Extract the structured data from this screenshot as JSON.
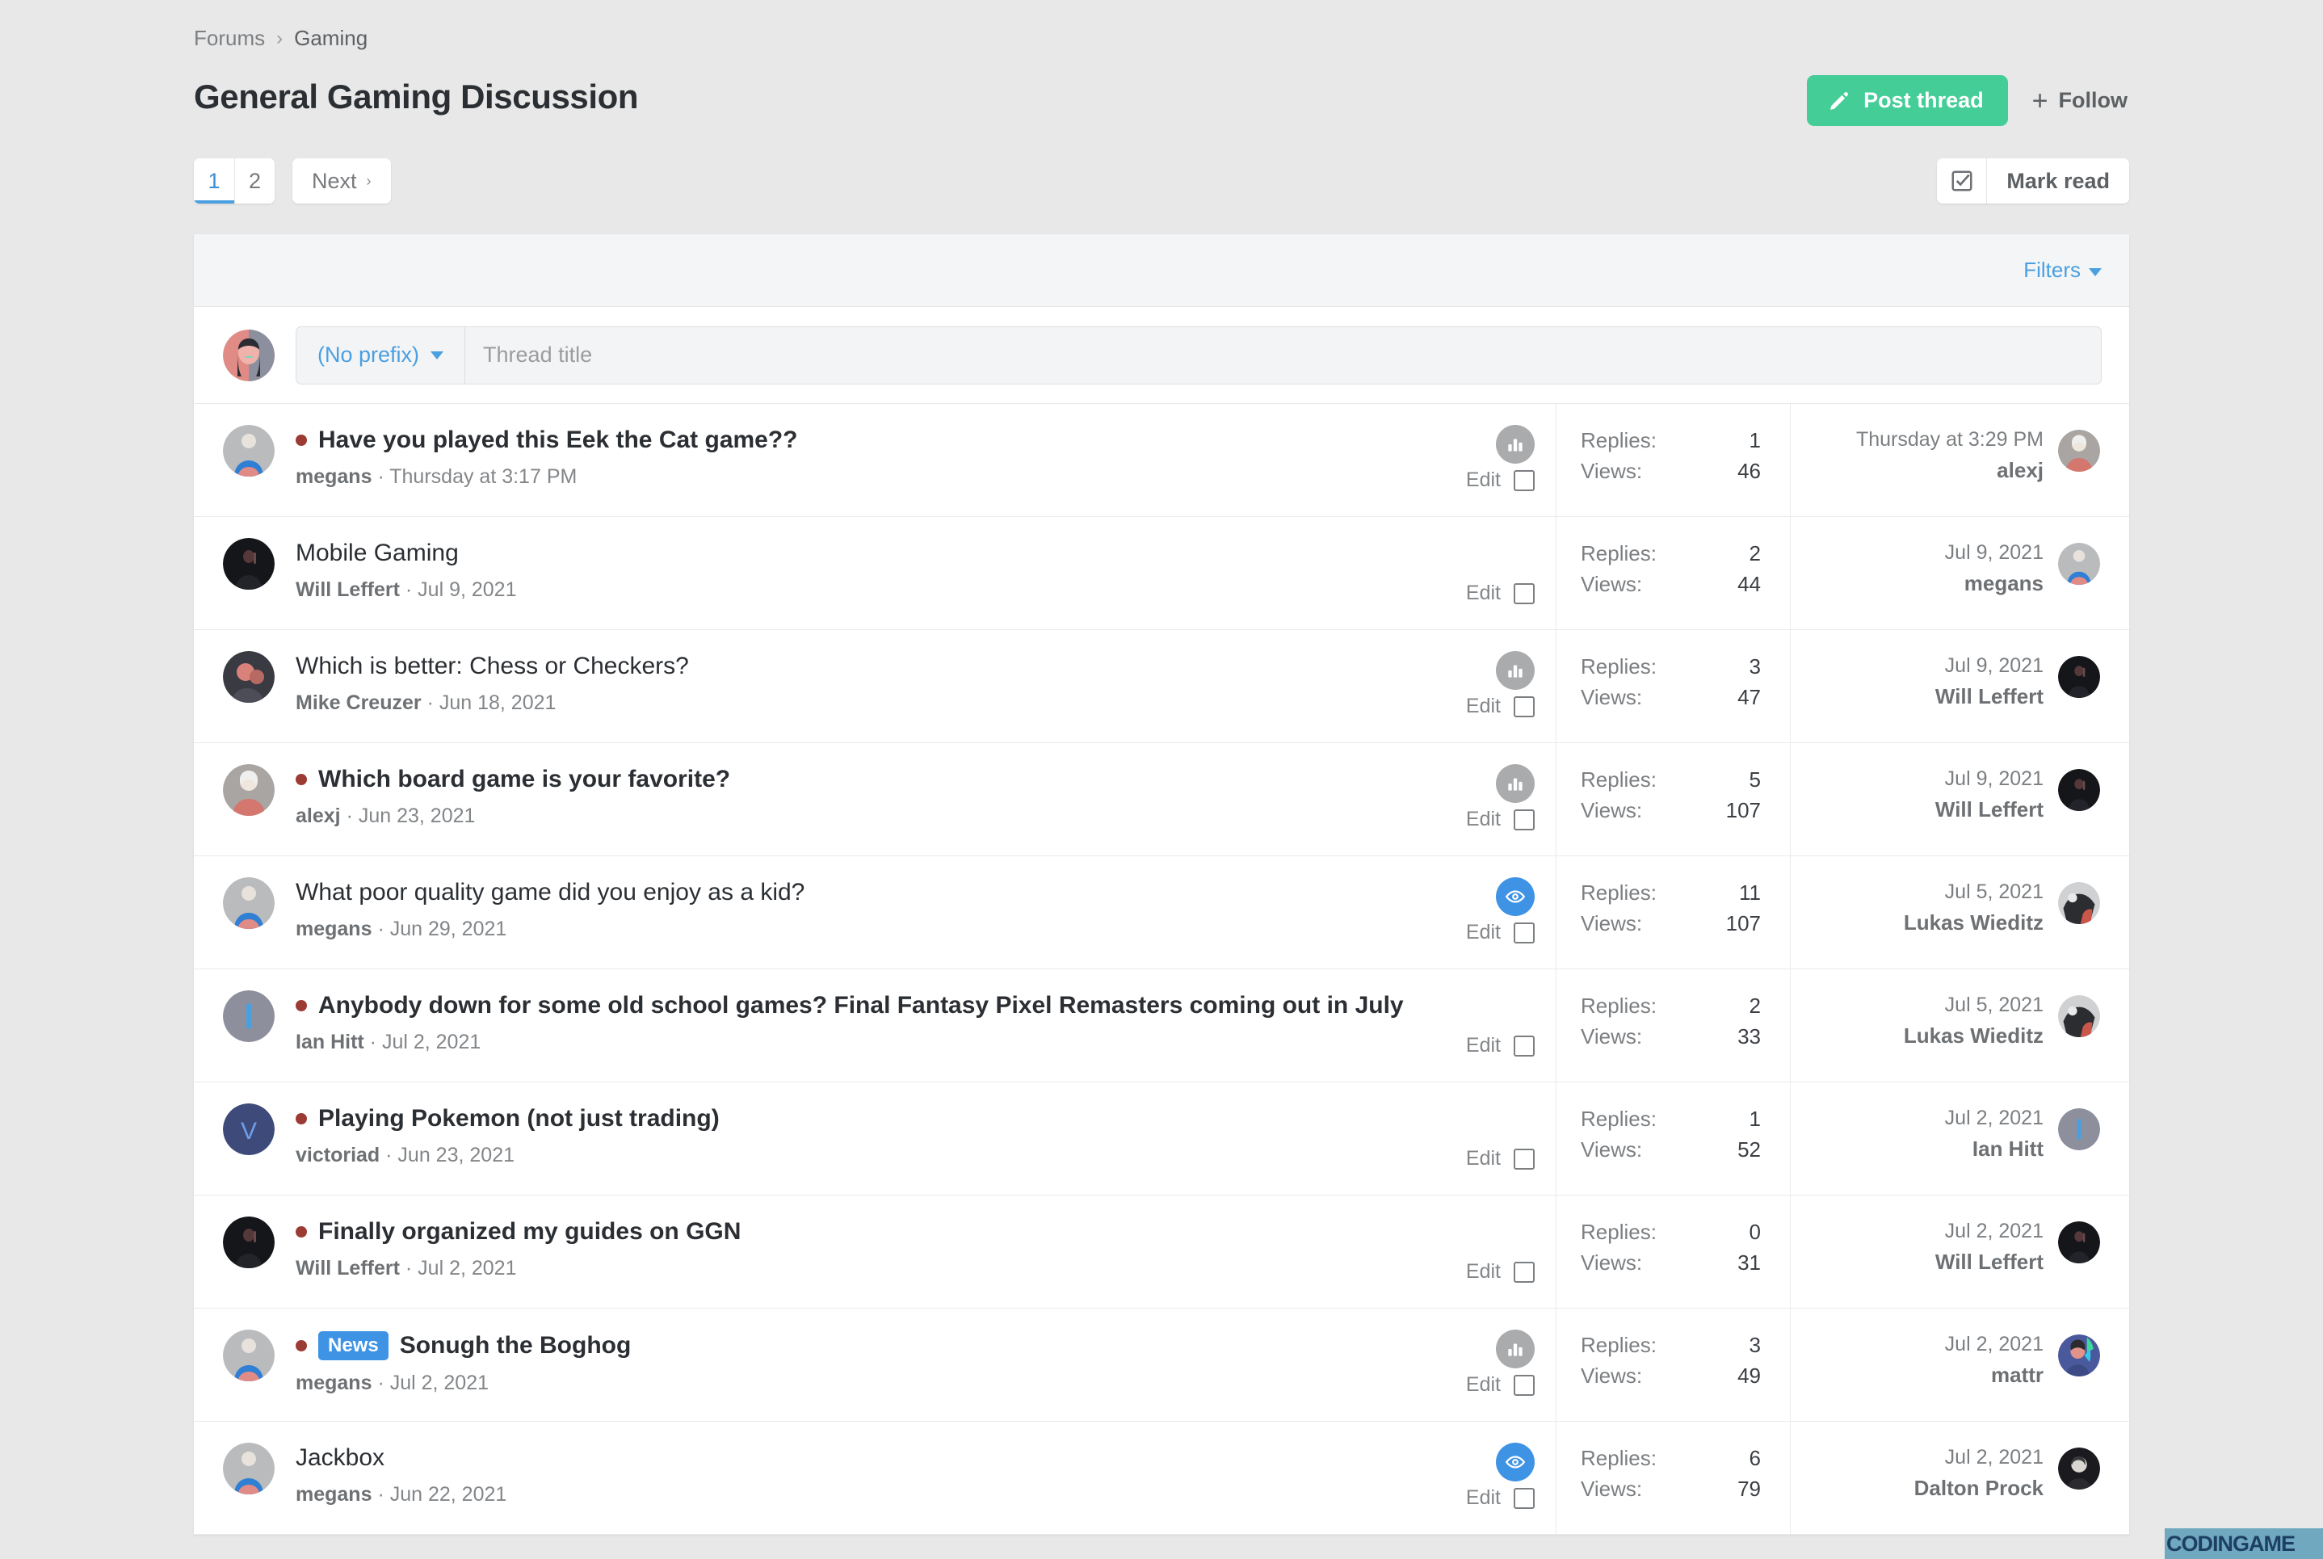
{
  "breadcrumb": {
    "root": "Forums",
    "separator": "›",
    "current": "Gaming"
  },
  "header": {
    "title": "General Gaming Discussion",
    "post_thread_label": "Post thread",
    "post_thread_color": "#45cd98",
    "follow_label": "Follow",
    "plus_glyph": "+"
  },
  "pagination": {
    "pages": [
      "1",
      "2"
    ],
    "active_page": "1",
    "next_label": "Next",
    "next_carat": "›"
  },
  "mark_read": {
    "label": "Mark read"
  },
  "filters": {
    "label": "Filters"
  },
  "quick_thread": {
    "prefix_label": "(No prefix)",
    "title_placeholder": "Thread title",
    "title_value": ""
  },
  "stats_labels": {
    "replies": "Replies:",
    "views": "Views:"
  },
  "row_tools": {
    "edit_label": "Edit"
  },
  "colors": {
    "accent_green": "#45cd98",
    "link_blue": "#4a9fe0",
    "badge_blue": "#3f93e5",
    "unread_dot": "#9c3b34",
    "poll_icon_bg": "#a9abad",
    "watch_icon_bg": "#3f93e5",
    "page_bg": "#e8e8e8"
  },
  "threads": [
    {
      "unread": true,
      "prefix": null,
      "title": "Have you played this Eek the Cat game??",
      "author": "megans",
      "date": "Thursday at 3:17 PM",
      "status_icon": "poll-icon",
      "replies": "1",
      "views": "46",
      "last_date": "Thursday at 3:29 PM",
      "last_user": "alexj",
      "avatar": "megans",
      "last_avatar": "alexj"
    },
    {
      "unread": false,
      "prefix": null,
      "title": "Mobile Gaming",
      "author": "Will Leffert",
      "date": "Jul 9, 2021",
      "status_icon": "none",
      "replies": "2",
      "views": "44",
      "last_date": "Jul 9, 2021",
      "last_user": "megans",
      "avatar": "will",
      "last_avatar": "megans"
    },
    {
      "unread": false,
      "prefix": null,
      "title": "Which is better: Chess or Checkers?",
      "author": "Mike Creuzer",
      "date": "Jun 18, 2021",
      "status_icon": "poll-icon",
      "replies": "3",
      "views": "47",
      "last_date": "Jul 9, 2021",
      "last_user": "Will Leffert",
      "avatar": "mike",
      "last_avatar": "will"
    },
    {
      "unread": true,
      "prefix": null,
      "title": "Which board game is your favorite?",
      "author": "alexj",
      "date": "Jun 23, 2021",
      "status_icon": "poll-icon",
      "replies": "5",
      "views": "107",
      "last_date": "Jul 9, 2021",
      "last_user": "Will Leffert",
      "avatar": "alexj",
      "last_avatar": "will"
    },
    {
      "unread": false,
      "prefix": null,
      "title": "What poor quality game did you enjoy as a kid?",
      "author": "megans",
      "date": "Jun 29, 2021",
      "status_icon": "watch-icon",
      "replies": "11",
      "views": "107",
      "last_date": "Jul 5, 2021",
      "last_user": "Lukas Wieditz",
      "avatar": "megans",
      "last_avatar": "lukas"
    },
    {
      "unread": true,
      "prefix": null,
      "title": "Anybody down for some old school games? Final Fantasy Pixel Remasters coming out in July",
      "author": "Ian Hitt",
      "date": "Jul 2, 2021",
      "status_icon": "none",
      "replies": "2",
      "views": "33",
      "last_date": "Jul 5, 2021",
      "last_user": "Lukas Wieditz",
      "avatar": "ian",
      "last_avatar": "lukas"
    },
    {
      "unread": true,
      "prefix": null,
      "title": "Playing Pokemon (not just trading)",
      "author": "victoriad",
      "date": "Jun 23, 2021",
      "status_icon": "none",
      "replies": "1",
      "views": "52",
      "last_date": "Jul 2, 2021",
      "last_user": "Ian Hitt",
      "avatar": "victoria",
      "last_avatar": "ian"
    },
    {
      "unread": true,
      "prefix": null,
      "title": "Finally organized my guides on GGN",
      "author": "Will Leffert",
      "date": "Jul 2, 2021",
      "status_icon": "none",
      "replies": "0",
      "views": "31",
      "last_date": "Jul 2, 2021",
      "last_user": "Will Leffert",
      "avatar": "will",
      "last_avatar": "will"
    },
    {
      "unread": true,
      "prefix": "News",
      "title": "Sonugh the Boghog",
      "author": "megans",
      "date": "Jul 2, 2021",
      "status_icon": "poll-icon",
      "replies": "3",
      "views": "49",
      "last_date": "Jul 2, 2021",
      "last_user": "mattr",
      "avatar": "megans",
      "last_avatar": "mattr"
    },
    {
      "unread": false,
      "prefix": null,
      "title": "Jackbox",
      "author": "megans",
      "date": "Jun 22, 2021",
      "status_icon": "watch-icon",
      "replies": "6",
      "views": "79",
      "last_date": "Jul 2, 2021",
      "last_user": "Dalton Prock",
      "avatar": "megans",
      "last_avatar": "dalton"
    }
  ],
  "watermark": {
    "text": "CODINGAME"
  }
}
